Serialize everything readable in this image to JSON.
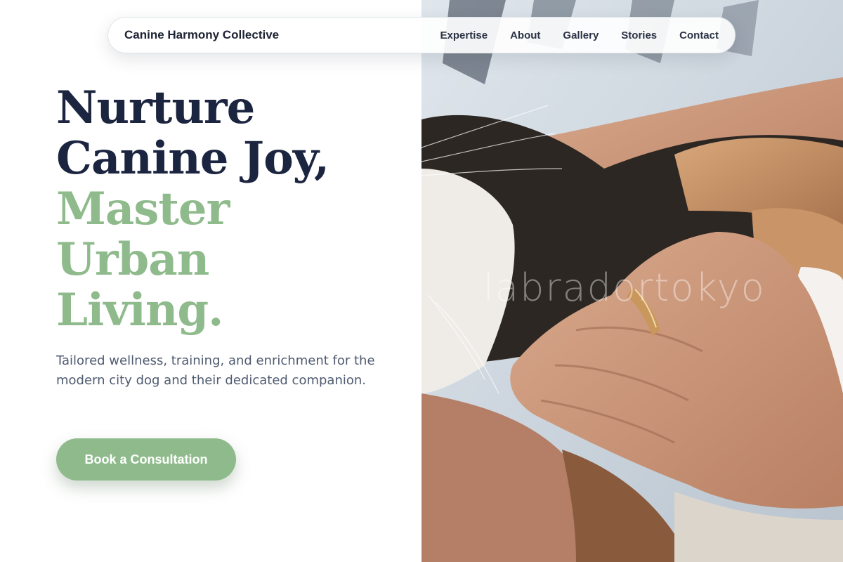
{
  "nav": {
    "brand": "Canine Harmony Collective",
    "links": [
      "Expertise",
      "About",
      "Gallery",
      "Stories",
      "Contact"
    ]
  },
  "hero": {
    "headline_dark": [
      "Nurture",
      "Canine Joy,"
    ],
    "headline_accent": [
      "Master",
      "Urban",
      "Living."
    ],
    "subtitle": "Tailored wellness, training, and enrichment for the modern city dog and their dedicated companion.",
    "cta_label": "Book a Consultation"
  },
  "photo": {
    "watermark": "labradortokyo",
    "subject": "hands stroking a calico cat"
  },
  "colors": {
    "headline_dark": "#1c2540",
    "accent_green": "#8fbb8c",
    "body_text": "#4f5b70"
  }
}
